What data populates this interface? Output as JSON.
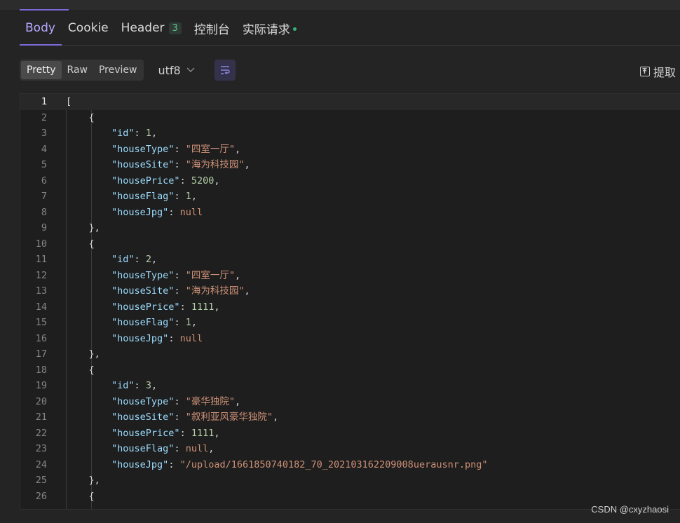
{
  "tabs": [
    {
      "label": "Body",
      "active": true
    },
    {
      "label": "Cookie",
      "active": false
    },
    {
      "label": "Header",
      "badge": "3",
      "active": false
    },
    {
      "label": "控制台",
      "active": false
    },
    {
      "label": "实际请求",
      "dot": true,
      "active": false
    }
  ],
  "toolbar": {
    "views": [
      {
        "label": "Pretty",
        "active": true
      },
      {
        "label": "Raw",
        "active": false
      },
      {
        "label": "Preview",
        "active": false
      }
    ],
    "encoding": "utf8",
    "extract_label": "提取"
  },
  "editor": {
    "current_line": 1,
    "lines": [
      [
        [
          "p",
          "["
        ]
      ],
      [
        [
          "p",
          "    {"
        ]
      ],
      [
        [
          "p",
          "        "
        ],
        [
          "k",
          "\"id\""
        ],
        [
          "p",
          ": "
        ],
        [
          "n",
          "1"
        ],
        [
          "p",
          ","
        ]
      ],
      [
        [
          "p",
          "        "
        ],
        [
          "k",
          "\"houseType\""
        ],
        [
          "p",
          ": "
        ],
        [
          "s",
          "\"四室一厅\""
        ],
        [
          "p",
          ","
        ]
      ],
      [
        [
          "p",
          "        "
        ],
        [
          "k",
          "\"houseSite\""
        ],
        [
          "p",
          ": "
        ],
        [
          "s",
          "\"海为科技园\""
        ],
        [
          "p",
          ","
        ]
      ],
      [
        [
          "p",
          "        "
        ],
        [
          "k",
          "\"housePrice\""
        ],
        [
          "p",
          ": "
        ],
        [
          "n",
          "5200"
        ],
        [
          "p",
          ","
        ]
      ],
      [
        [
          "p",
          "        "
        ],
        [
          "k",
          "\"houseFlag\""
        ],
        [
          "p",
          ": "
        ],
        [
          "n",
          "1"
        ],
        [
          "p",
          ","
        ]
      ],
      [
        [
          "p",
          "        "
        ],
        [
          "k",
          "\"houseJpg\""
        ],
        [
          "p",
          ": "
        ],
        [
          "nl",
          "null"
        ]
      ],
      [
        [
          "p",
          "    },"
        ]
      ],
      [
        [
          "p",
          "    {"
        ]
      ],
      [
        [
          "p",
          "        "
        ],
        [
          "k",
          "\"id\""
        ],
        [
          "p",
          ": "
        ],
        [
          "n",
          "2"
        ],
        [
          "p",
          ","
        ]
      ],
      [
        [
          "p",
          "        "
        ],
        [
          "k",
          "\"houseType\""
        ],
        [
          "p",
          ": "
        ],
        [
          "s",
          "\"四室一厅\""
        ],
        [
          "p",
          ","
        ]
      ],
      [
        [
          "p",
          "        "
        ],
        [
          "k",
          "\"houseSite\""
        ],
        [
          "p",
          ": "
        ],
        [
          "s",
          "\"海为科技园\""
        ],
        [
          "p",
          ","
        ]
      ],
      [
        [
          "p",
          "        "
        ],
        [
          "k",
          "\"housePrice\""
        ],
        [
          "p",
          ": "
        ],
        [
          "n",
          "1111"
        ],
        [
          "p",
          ","
        ]
      ],
      [
        [
          "p",
          "        "
        ],
        [
          "k",
          "\"houseFlag\""
        ],
        [
          "p",
          ": "
        ],
        [
          "n",
          "1"
        ],
        [
          "p",
          ","
        ]
      ],
      [
        [
          "p",
          "        "
        ],
        [
          "k",
          "\"houseJpg\""
        ],
        [
          "p",
          ": "
        ],
        [
          "nl",
          "null"
        ]
      ],
      [
        [
          "p",
          "    },"
        ]
      ],
      [
        [
          "p",
          "    {"
        ]
      ],
      [
        [
          "p",
          "        "
        ],
        [
          "k",
          "\"id\""
        ],
        [
          "p",
          ": "
        ],
        [
          "n",
          "3"
        ],
        [
          "p",
          ","
        ]
      ],
      [
        [
          "p",
          "        "
        ],
        [
          "k",
          "\"houseType\""
        ],
        [
          "p",
          ": "
        ],
        [
          "s",
          "\"豪华独院\""
        ],
        [
          "p",
          ","
        ]
      ],
      [
        [
          "p",
          "        "
        ],
        [
          "k",
          "\"houseSite\""
        ],
        [
          "p",
          ": "
        ],
        [
          "s",
          "\"叙利亚风豪华独院\""
        ],
        [
          "p",
          ","
        ]
      ],
      [
        [
          "p",
          "        "
        ],
        [
          "k",
          "\"housePrice\""
        ],
        [
          "p",
          ": "
        ],
        [
          "n",
          "1111"
        ],
        [
          "p",
          ","
        ]
      ],
      [
        [
          "p",
          "        "
        ],
        [
          "k",
          "\"houseFlag\""
        ],
        [
          "p",
          ": "
        ],
        [
          "nl",
          "null"
        ],
        [
          "p",
          ","
        ]
      ],
      [
        [
          "p",
          "        "
        ],
        [
          "k",
          "\"houseJpg\""
        ],
        [
          "p",
          ": "
        ],
        [
          "s",
          "\"/upload/1661850740182_70_202103162209008uerausnr.png\""
        ]
      ],
      [
        [
          "p",
          "    },"
        ]
      ],
      [
        [
          "p",
          "    {"
        ]
      ]
    ]
  },
  "watermark": "CSDN @cxyzhaosi"
}
